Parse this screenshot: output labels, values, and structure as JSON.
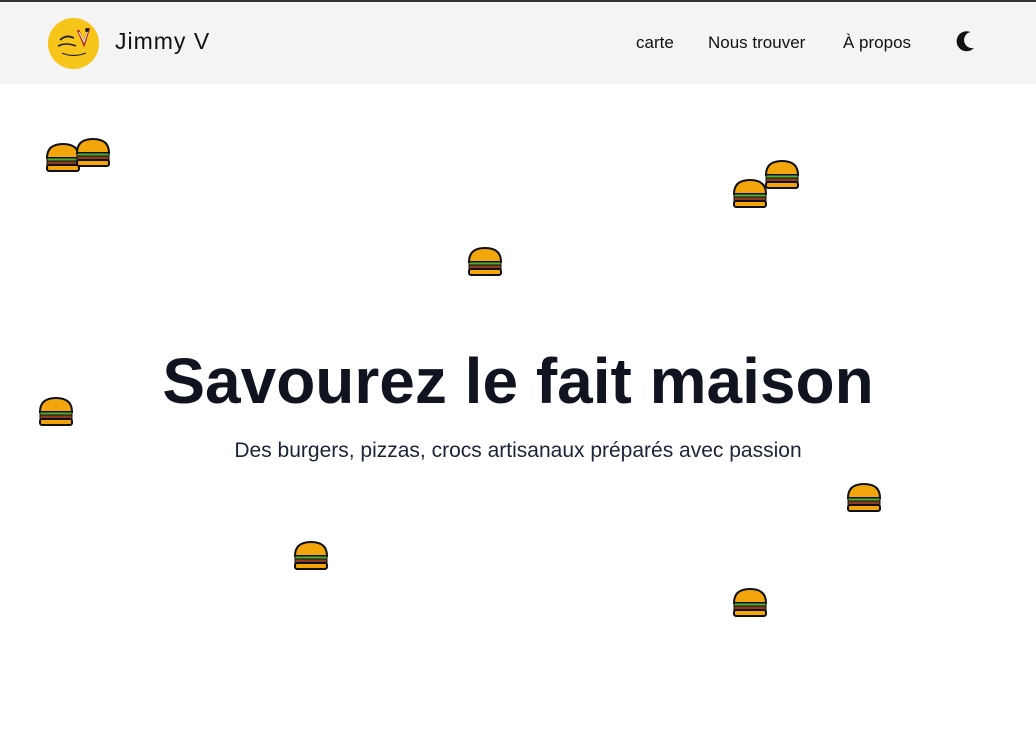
{
  "header": {
    "brand": "Jimmy V",
    "logo_icon": "jimmy-v-logo-icon",
    "nav": [
      {
        "label": "carte"
      },
      {
        "label": "Nous trouver"
      },
      {
        "label": "À propos"
      }
    ],
    "theme_toggle_icon": "moon-icon"
  },
  "hero": {
    "title": "Savourez le fait maison",
    "subtitle": "Des burgers, pizzas, crocs artisanaux préparés avec passion"
  },
  "decor": {
    "burger_icon": "burger-icon",
    "colors": {
      "bun": "#f2a60c",
      "patty": "#8b3b1f",
      "lettuce": "#4caf32",
      "outline": "#111111",
      "logo": "#f7c51a"
    }
  }
}
